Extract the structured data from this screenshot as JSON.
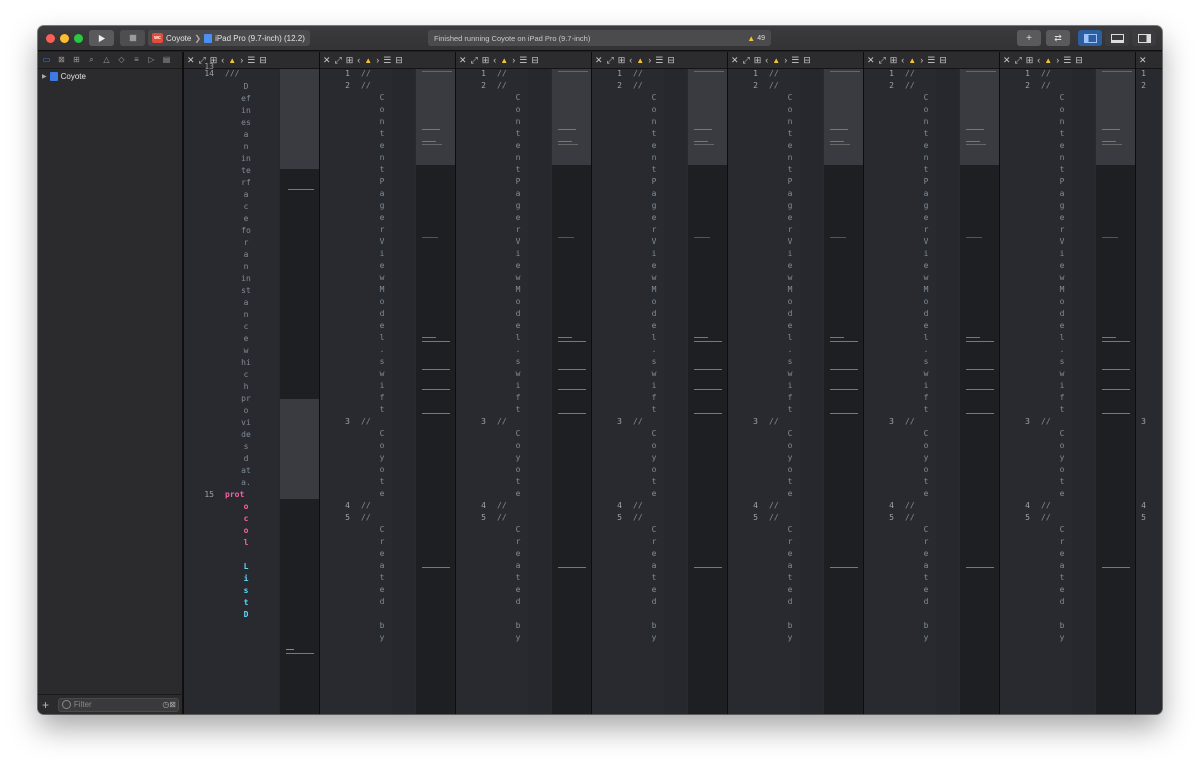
{
  "window": {
    "title_scheme": "Coyote",
    "destination": "iPad Pro (9.7-inch) (12.2)",
    "status_text": "Finished running Coyote on iPad Pro (9.7-inch)",
    "warnings_count": "49",
    "app_icon_text": "wc"
  },
  "toolbar": {
    "run_icon": "play-icon",
    "stop_icon": "stop-icon",
    "add_icon": "plus-icon",
    "review_icon": "swap-arrows-icon",
    "layout_icons": [
      "navigator-toggle-icon",
      "debug-area-toggle-icon",
      "inspector-toggle-icon"
    ]
  },
  "navigator": {
    "tabs": [
      "folder-icon",
      "source-control-icon",
      "hierarchy-icon",
      "search-icon",
      "warning-icon",
      "test-icon",
      "debug-icon",
      "breakpoint-icon",
      "report-icon"
    ],
    "root_item": "Coyote",
    "filter_placeholder": "Filter",
    "add_symbol": "+"
  },
  "first_pane": {
    "line_partial": "13",
    "comment_line_no": "14",
    "comment_slashes": "///",
    "comment_chunks": [
      "D",
      "ef",
      "in",
      "es",
      "a",
      "n",
      "in",
      "te",
      "rf",
      "a",
      "c",
      "e",
      "fo",
      "r",
      "a",
      "n",
      "in",
      "st",
      "a",
      "n",
      "c",
      "e",
      "w",
      "hi",
      "c",
      "h",
      "pr",
      "o",
      "vi",
      "de",
      "s",
      "d",
      "at",
      "a."
    ],
    "keyword_line_no": "15",
    "keyword_chunks": [
      "prot",
      "o",
      "c",
      "o",
      "l"
    ],
    "type_chunks": [
      "L",
      "i",
      "s",
      "t",
      "D"
    ]
  },
  "panes_common": {
    "line1": {
      "no": "1",
      "text": "//"
    },
    "line2": {
      "no": "2",
      "text": "//",
      "chars": [
        "C",
        "o",
        "n",
        "t",
        "e",
        "n",
        "t",
        "P",
        "a",
        "g",
        "e",
        "r",
        "V",
        "i",
        "e",
        "w",
        "M",
        "o",
        "d",
        "e",
        "l",
        ".",
        "s",
        "w",
        "i",
        "f",
        "t"
      ]
    },
    "line3": {
      "no": "3",
      "text": "//",
      "chars": [
        "C",
        "o",
        "y",
        "o",
        "t",
        "e"
      ]
    },
    "line4": {
      "no": "4",
      "text": "//"
    },
    "line5": {
      "no": "5",
      "text": "//",
      "chars": [
        "C",
        "r",
        "e",
        "a",
        "t",
        "e",
        "d",
        "",
        "b",
        "y"
      ]
    }
  },
  "last_pane_numbers": [
    "1",
    "2",
    "3",
    "4",
    "5"
  ],
  "colors": {
    "keyword": "#fc5fa3",
    "type": "#5dd8ff",
    "comment": "#7f8c98",
    "minimap_mark": "#c65467"
  }
}
